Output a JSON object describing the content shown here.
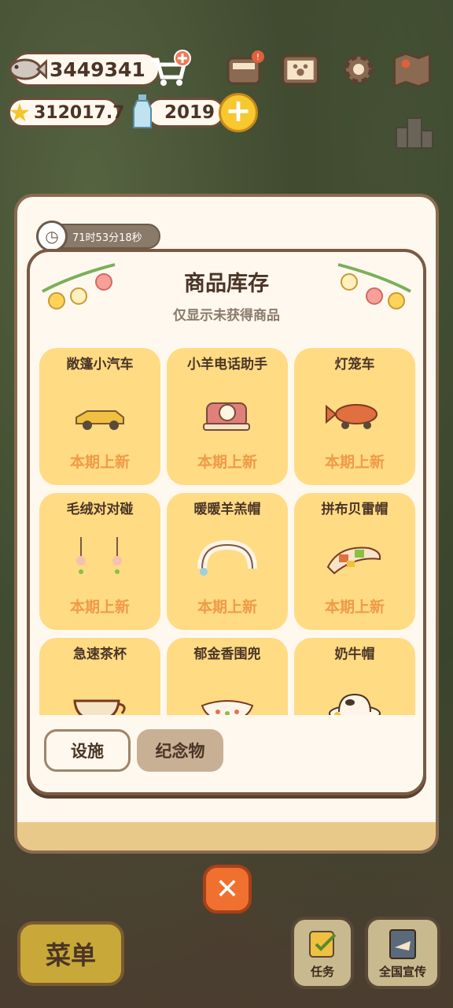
{
  "hud": {
    "fish_count": "3449341",
    "star_count": "312017.7",
    "bottle_count": "2019"
  },
  "timer": {
    "remaining": "71时53分18秒"
  },
  "modal": {
    "title": "商品库存",
    "subtitle": "仅显示未获得商品",
    "items": [
      {
        "name": "敞篷小汽车",
        "badge": "本期上新",
        "icon": "convertible-car-icon"
      },
      {
        "name": "小羊电话助手",
        "badge": "本期上新",
        "icon": "sheep-phone-icon"
      },
      {
        "name": "灯笼车",
        "badge": "本期上新",
        "icon": "lantern-car-icon"
      },
      {
        "name": "毛绒对对碰",
        "badge": "本期上新",
        "icon": "plush-earrings-icon"
      },
      {
        "name": "暖暖羊羔帽",
        "badge": "本期上新",
        "icon": "lamb-hat-icon"
      },
      {
        "name": "拼布贝雷帽",
        "badge": "本期上新",
        "icon": "patchwork-beret-icon"
      },
      {
        "name": "急速茶杯",
        "badge": "",
        "icon": "teacup-car-icon"
      },
      {
        "name": "郁金香围兜",
        "badge": "",
        "icon": "tulip-bib-icon"
      },
      {
        "name": "奶牛帽",
        "badge": "",
        "icon": "cow-hat-icon"
      }
    ],
    "tabs": {
      "facility": "设施",
      "souvenir": "纪念物"
    }
  },
  "bottom": {
    "menu_label": "菜单",
    "task_label": "任务",
    "promo_label": "全国宣传"
  },
  "colors": {
    "card": "#ffdb84",
    "badge": "#f09a48",
    "close": "#f07030"
  }
}
